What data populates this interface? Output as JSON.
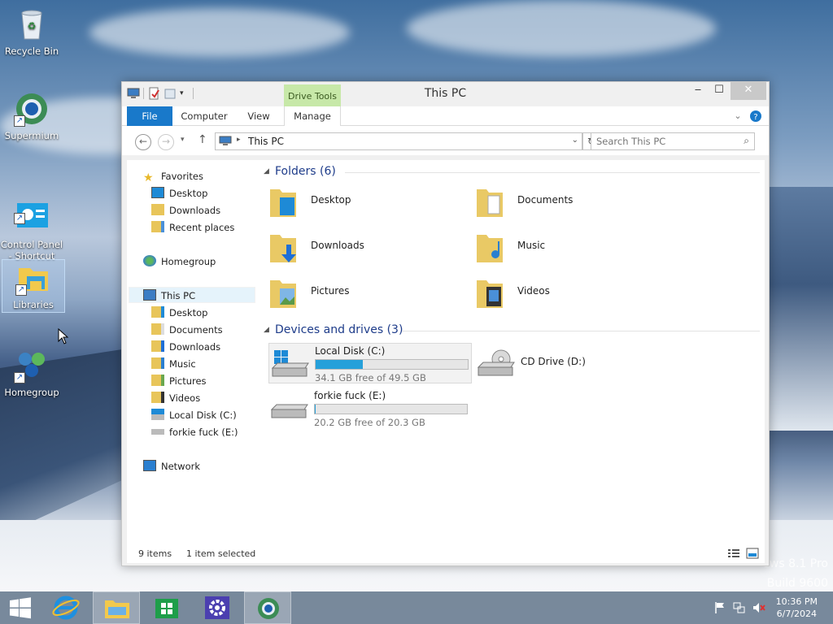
{
  "desktop": {
    "icons": [
      {
        "label": "Recycle Bin"
      },
      {
        "label": "Supermium"
      },
      {
        "label": "Control Panel\n- Shortcut"
      },
      {
        "label": "Libraries"
      },
      {
        "label": "Homegroup"
      }
    ],
    "watermark": [
      "ows 8.1 Pro",
      "Build 9600"
    ]
  },
  "window": {
    "title": "This PC",
    "contextual_tab": "Drive Tools",
    "tabs": [
      "File",
      "Computer",
      "View",
      "Manage"
    ],
    "address": "This PC",
    "search_placeholder": "Search This PC"
  },
  "nav_pane": {
    "favorites": {
      "label": "Favorites",
      "items": [
        "Desktop",
        "Downloads",
        "Recent places"
      ]
    },
    "homegroup": "Homegroup",
    "this_pc": {
      "label": "This PC",
      "items": [
        "Desktop",
        "Documents",
        "Downloads",
        "Music",
        "Pictures",
        "Videos",
        "Local Disk (C:)",
        "forkie fuck (E:)"
      ]
    },
    "network": "Network"
  },
  "main": {
    "folders_header": "Folders (6)",
    "folders": [
      "Desktop",
      "Documents",
      "Downloads",
      "Music",
      "Pictures",
      "Videos"
    ],
    "devices_header": "Devices and drives (3)",
    "drives": [
      {
        "name": "Local Disk (C:)",
        "free": "34.1 GB free of 49.5 GB",
        "used_fraction": 0.31
      },
      {
        "name": "CD Drive (D:)"
      },
      {
        "name": "forkie fuck (E:)",
        "free": "20.2 GB free of 20.3 GB",
        "used_fraction": 0.005
      }
    ]
  },
  "status": {
    "items": "9 items",
    "selected": "1 item selected"
  },
  "taskbar": {
    "time": "10:36 PM",
    "date": "6/7/2024"
  },
  "colors": {
    "accent": "#1979ca",
    "drive_bar": "#26a0da",
    "drive_tools_tab": "#c7e8a8",
    "group_heading": "#1e3c8a"
  }
}
